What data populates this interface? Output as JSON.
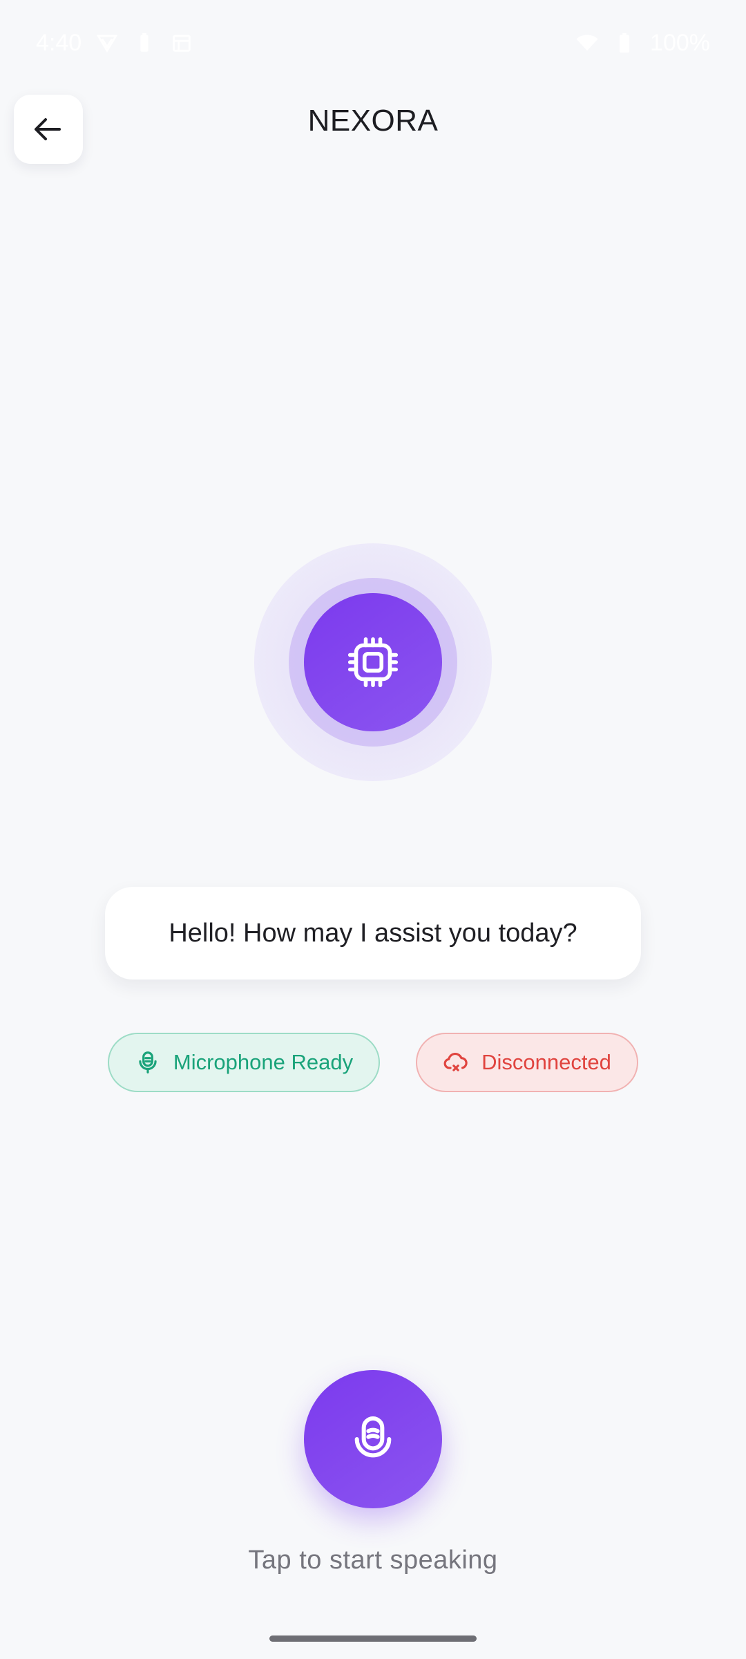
{
  "status_bar": {
    "time": "4:40",
    "battery_text": "100%",
    "icons": [
      "vpn-icon",
      "battery-saver-icon",
      "calendar-icon",
      "wifi-icon",
      "battery-icon"
    ]
  },
  "header": {
    "title": "NEXORA",
    "back_icon": "arrow-left-icon"
  },
  "assistant": {
    "avatar_icon": "cpu-chip-icon",
    "message": "Hello! How may I assist you today?"
  },
  "status_chips": {
    "microphone": {
      "label": "Microphone Ready",
      "icon": "microphone-icon",
      "color": "#1aa37a"
    },
    "connection": {
      "label": "Disconnected",
      "icon": "cloud-offline-icon",
      "color": "#e0443f"
    }
  },
  "voice_control": {
    "icon": "microphone-icon",
    "hint": "Tap to start speaking"
  },
  "colors": {
    "accent": "#7c3aed",
    "background": "#f7f8fa"
  }
}
